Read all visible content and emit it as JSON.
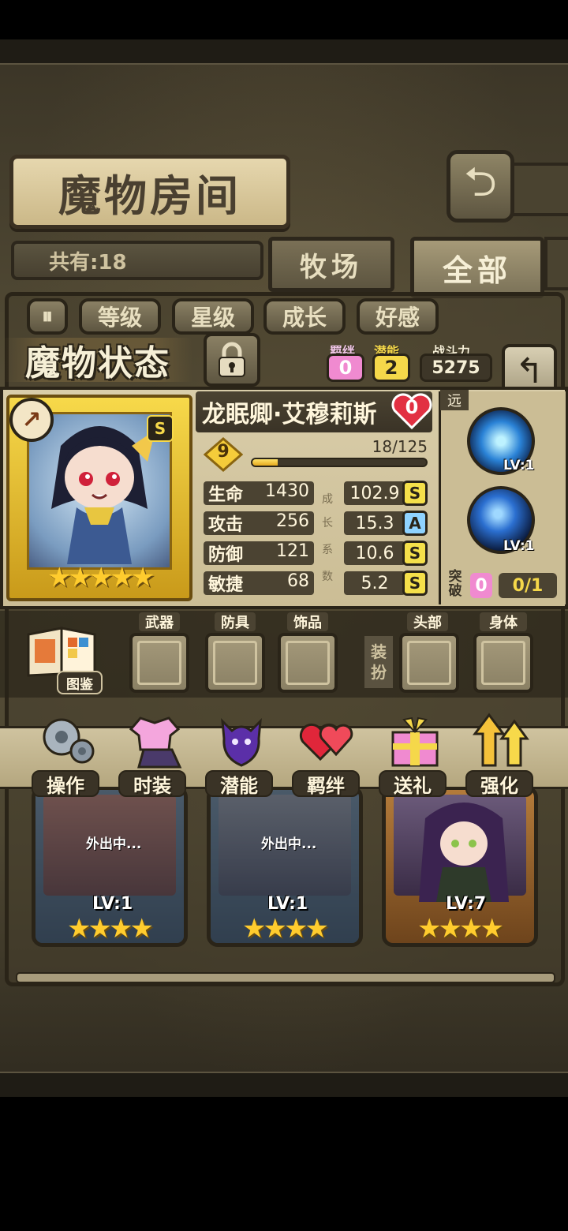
{
  "header": {
    "title": "魔物房间",
    "back_label": "⮌"
  },
  "filters": {
    "count": "共有:18",
    "tab_field": "牧场",
    "tab_all": "全部"
  },
  "sort": {
    "toggle": "⏸",
    "buttons": [
      "等级",
      "星级",
      "成长",
      "好感"
    ]
  },
  "status": {
    "title": "魔物状态",
    "bond_label": "羁绊",
    "bond_value": "0",
    "potential_label": "潜能",
    "potential_value": "2",
    "power_label": "战斗力",
    "power_value": "5275"
  },
  "monster": {
    "name": "龙眠卿·艾穆莉斯",
    "affection": "0",
    "level": "9",
    "xp": "18/125",
    "xp_fraction": 0.144,
    "star_count": 5,
    "rank_badge": "S",
    "stats": [
      {
        "name": "生命",
        "value": "1430",
        "growth": "102.9",
        "grade": "S"
      },
      {
        "name": "攻击",
        "value": "256",
        "growth": "15.3",
        "grade": "A"
      },
      {
        "name": "防御",
        "value": "121",
        "growth": "10.6",
        "grade": "S"
      },
      {
        "name": "敏捷",
        "value": "68",
        "growth": "5.2",
        "grade": "S"
      }
    ],
    "growth_vertical": [
      "成",
      "长",
      "系",
      "数"
    ],
    "range": "远",
    "skills": [
      {
        "level": "LV:1"
      },
      {
        "level": "LV:1"
      }
    ],
    "breakthrough_label_1": "突",
    "breakthrough_label_2": "破",
    "breakthrough_value": "0",
    "breakthrough_progress": "0/1"
  },
  "equipment": {
    "codex_label": "图鉴",
    "slots": [
      "武器",
      "防具",
      "饰品",
      "头部",
      "身体"
    ],
    "dress_label_1": "装",
    "dress_label_2": "扮"
  },
  "actions": [
    "操作",
    "时装",
    "潜能",
    "羁绊",
    "送礼",
    "强化"
  ],
  "cards": [
    {
      "status": "外出中...",
      "level": "LV:1",
      "stars": "★★★★"
    },
    {
      "status": "外出中...",
      "level": "LV:1",
      "stars": "★★★★"
    },
    {
      "status": "",
      "level": "LV:7",
      "stars": "★★★★"
    }
  ],
  "colors": {
    "gold": "#f7d94a",
    "grade_s": "#f5e04a",
    "grade_a": "#8fd3ff",
    "bond": "#f08ad0",
    "potential": "#f5d84a"
  }
}
